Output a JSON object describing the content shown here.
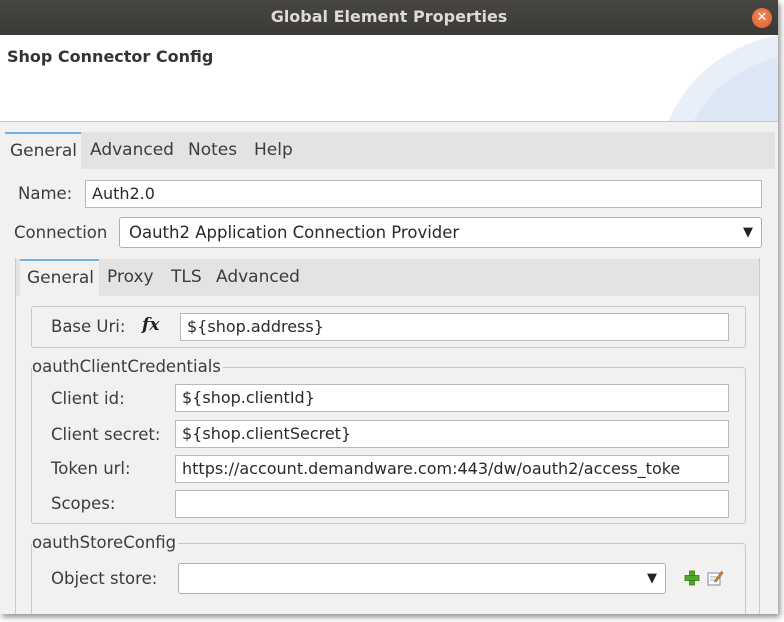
{
  "window": {
    "title": "Global Element Properties"
  },
  "header": {
    "title": "Shop Connector Config"
  },
  "outer_tabs": [
    "General",
    "Advanced",
    "Notes",
    "Help"
  ],
  "name_field": {
    "label": "Name:",
    "value": "Auth2.0"
  },
  "connection": {
    "label": "Connection",
    "value": "Oauth2 Application Connection Provider"
  },
  "inner_tabs": [
    "General",
    "Proxy",
    "TLS",
    "Advanced"
  ],
  "base_uri": {
    "label": "Base Uri:",
    "value": "${shop.address}"
  },
  "credentials": {
    "legend": "oauthClientCredentials",
    "client_id": {
      "label": "Client id:",
      "value": "${shop.clientId}"
    },
    "client_secret": {
      "label": "Client secret:",
      "value": "${shop.clientSecret}"
    },
    "token_url": {
      "label": "Token url:",
      "value": "https://account.demandware.com:443/dw/oauth2/access_toke"
    },
    "scopes": {
      "label": "Scopes:",
      "value": ""
    }
  },
  "store_config": {
    "legend": "oauthStoreConfig",
    "object_store": {
      "label": "Object store:",
      "value": ""
    }
  },
  "icons": {
    "close": "close-icon",
    "fx": "expression-icon",
    "add": "add-icon",
    "edit": "edit-icon",
    "dropdown": "chevron-down-icon"
  },
  "colors": {
    "tab_accent": "#6fb2e8",
    "close": "#e15a26",
    "add": "#4ea82a"
  }
}
